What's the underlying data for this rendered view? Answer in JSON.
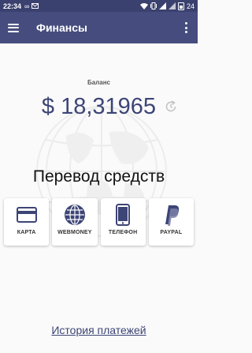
{
  "status_bar": {
    "time": "22:34",
    "infinity_glyph": "∞",
    "battery_level": "24"
  },
  "app_bar": {
    "title": "Финансы"
  },
  "balance": {
    "label": "Баланс",
    "amount": "$ 18,31965"
  },
  "transfer": {
    "heading": "Перевод средств",
    "methods": [
      {
        "label": "КАРТА",
        "icon": "card-icon"
      },
      {
        "label": "WEBMONEY",
        "icon": "webmoney-icon"
      },
      {
        "label": "ТЕЛЕФОН",
        "icon": "phone-icon"
      },
      {
        "label": "PAYPAL",
        "icon": "paypal-icon"
      }
    ]
  },
  "history_link": "История платежей",
  "colors": {
    "primary": "#464d7e",
    "status_bar": "#3b416e",
    "accent_text": "#3d4576"
  }
}
